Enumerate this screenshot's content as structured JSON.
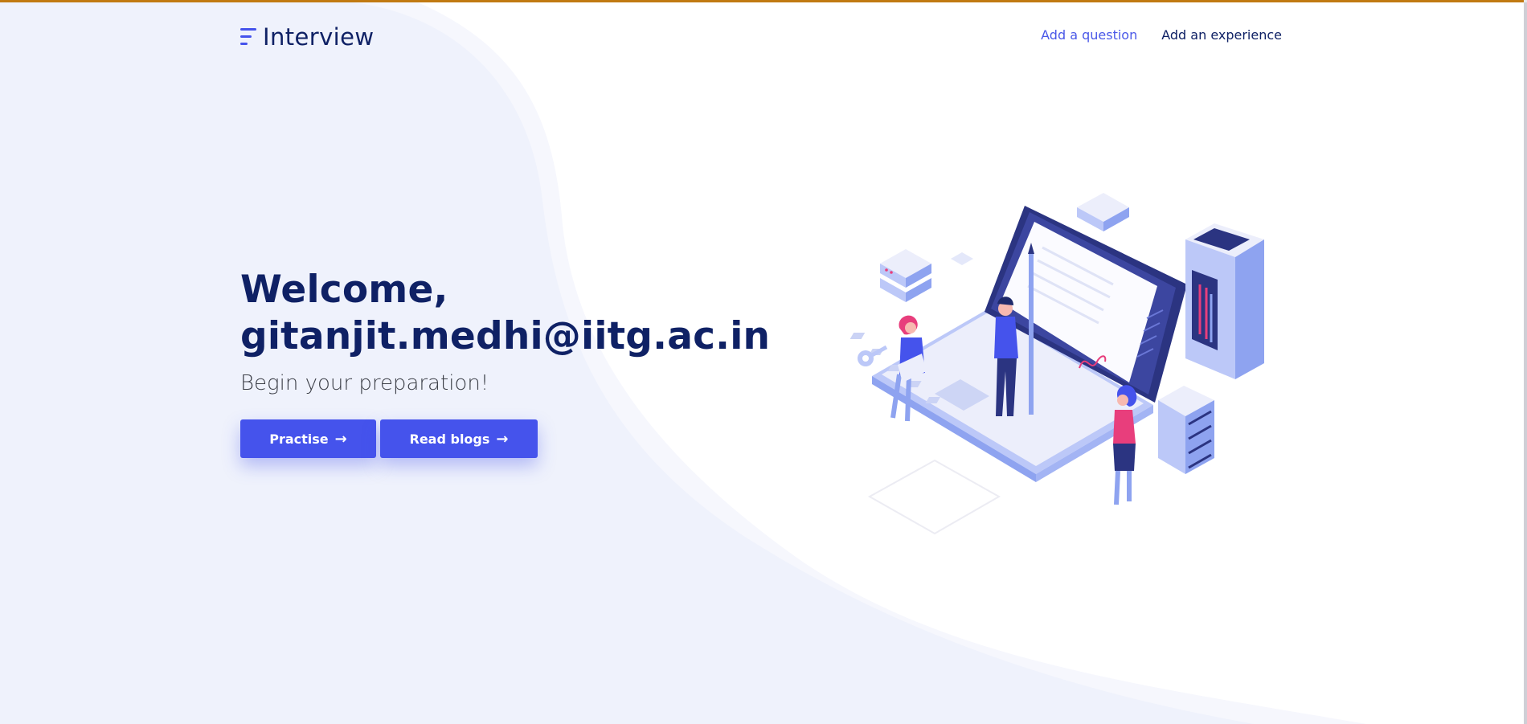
{
  "header": {
    "logo_text": "Interview",
    "nav": {
      "add_question": "Add a question",
      "add_experience": "Add an experience"
    }
  },
  "hero": {
    "welcome": "Welcome,",
    "email": "gitanjit.medhi@iitg.ac.in",
    "subtitle": "Begin your preparation!",
    "buttons": {
      "practise": "Practise",
      "read_blogs": "Read blogs"
    }
  },
  "colors": {
    "accent": "#4553ec",
    "heading": "#0f2165",
    "top_border": "#c17a12"
  },
  "icons": {
    "logo": "menu-lines-icon",
    "button_arrow": "arrow-right-icon"
  }
}
